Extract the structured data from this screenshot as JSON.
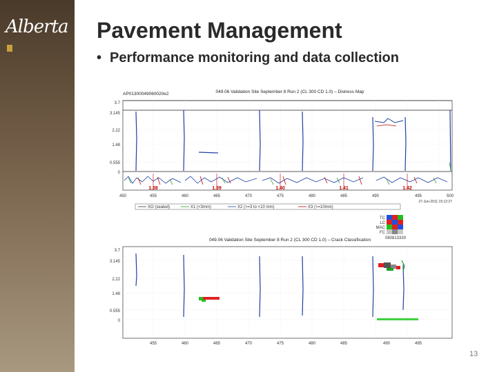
{
  "slide": {
    "logo_text": "Alberta",
    "title": "Pavement Management",
    "bullet": "Performance monitoring and data collection",
    "slide_number": "13"
  },
  "plot1": {
    "title": "049.06 Validation Site September 8 Run 2 (CL 300 CD 1.0) – Distress Map",
    "corner_label": "AP01300049060020e2",
    "y_ticks": [
      "3.7",
      "3.145",
      "2.22",
      "1.48",
      "0.555",
      "0"
    ],
    "x_ticks": [
      "450",
      "455",
      "460",
      "465",
      "470",
      "475",
      "480",
      "485",
      "490",
      "495",
      "500"
    ],
    "chainage_markers": [
      "1.38",
      "1.39",
      "1.40",
      "1.41",
      "1.42"
    ],
    "legend": [
      "XO (sealed)",
      "X1 (<3mm)",
      "X2 (>=3 to <10 mm)",
      "X3 (>=10mm)"
    ],
    "timestamp": "27-Jun-2011 15:12:27"
  },
  "crack_legend": {
    "rows": [
      "TC",
      "LC",
      "MAC",
      "FC"
    ],
    "label": "080813330"
  },
  "plot2": {
    "title": "049.06 Validation Site September 8 Run 2 (CL 300 CD 1.0) – Crack Classification",
    "y_ticks": [
      "3.7",
      "3.145",
      "2.22",
      "1.48",
      "0.555",
      "0"
    ],
    "x_ticks": [
      "455",
      "460",
      "465",
      "470",
      "475",
      "480",
      "485",
      "490",
      "495"
    ]
  }
}
